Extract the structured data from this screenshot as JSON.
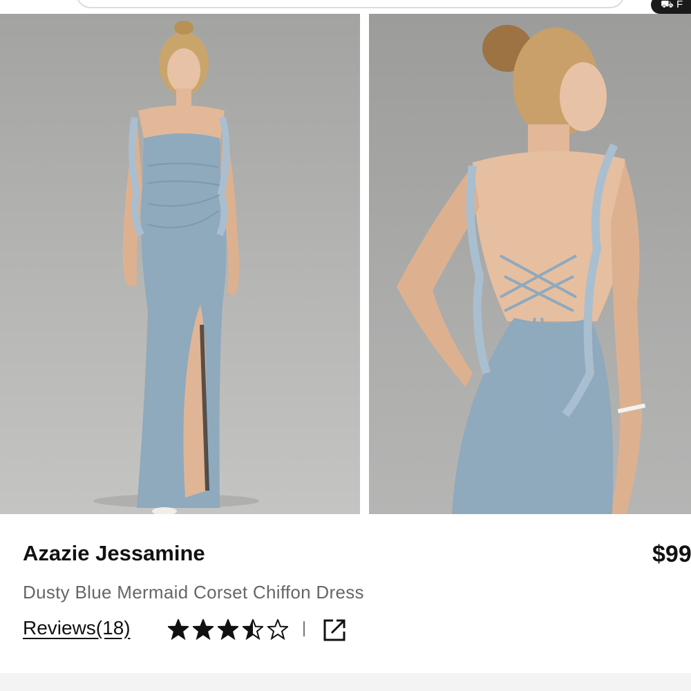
{
  "header": {
    "cart_text": "⛟ F"
  },
  "gallery": {
    "images": [
      {
        "name": "front view"
      },
      {
        "name": "back view"
      }
    ]
  },
  "product": {
    "brand": "Azazie Jessamine",
    "price": "$99",
    "name": "Dusty Blue Mermaid Corset Chiffon Dress",
    "reviews_label": "Reviews(18)",
    "rating": 3.5,
    "rating_max": 5
  },
  "colors": {
    "dress": "#8fa9bd",
    "text": "#111111",
    "subtle": "#666666"
  }
}
